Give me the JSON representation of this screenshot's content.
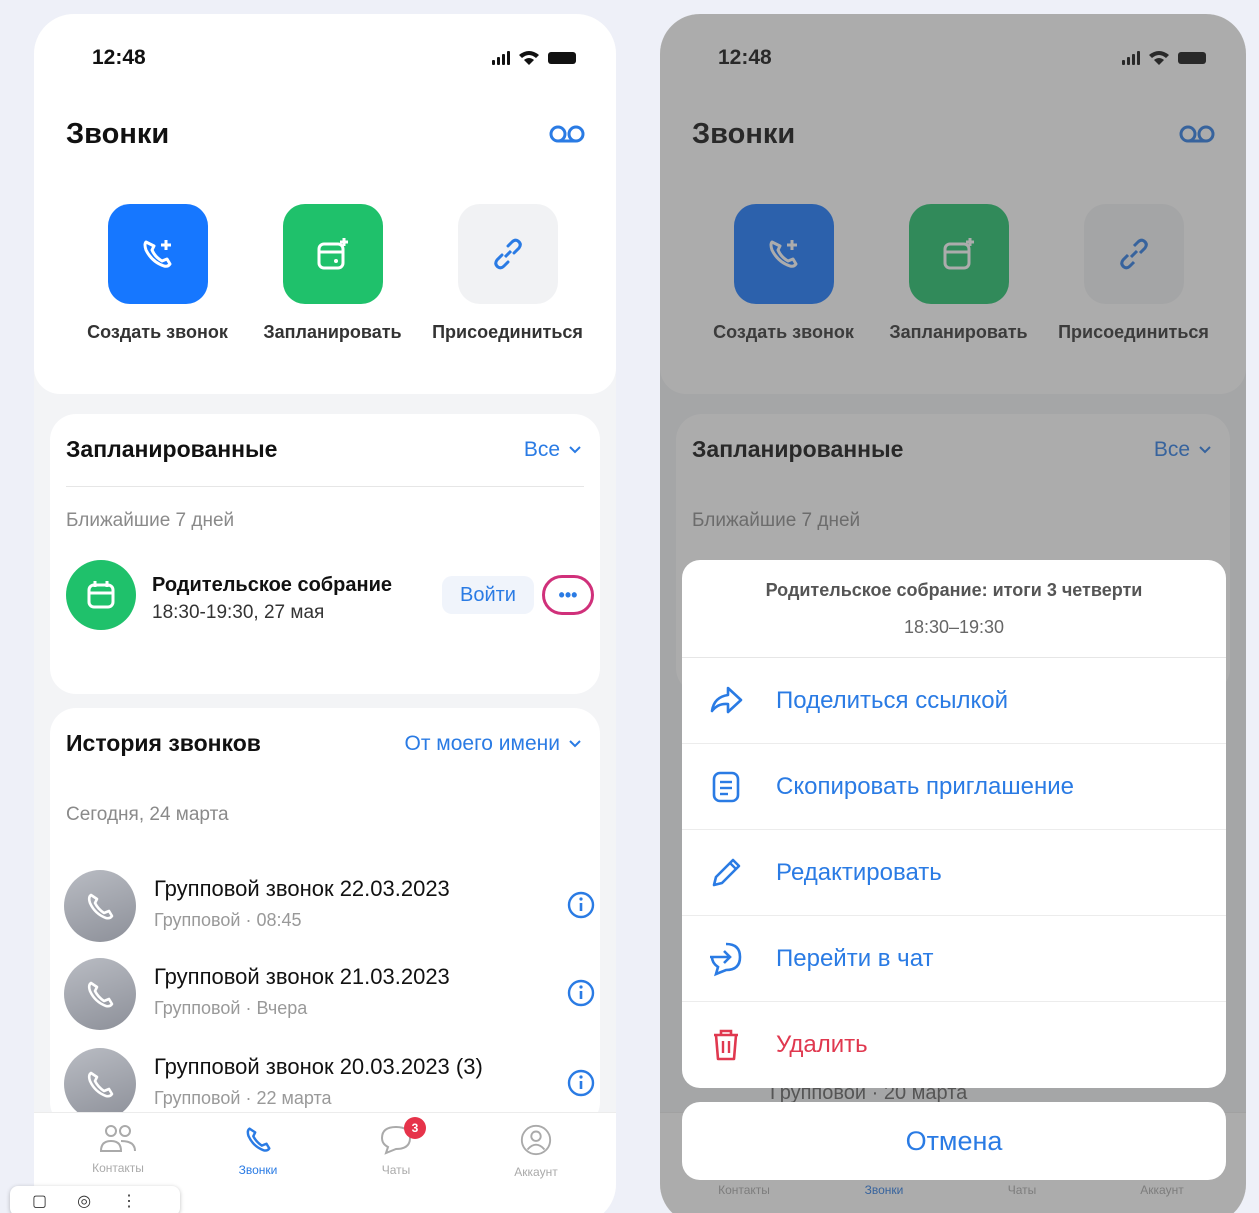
{
  "status": {
    "time": "12:48"
  },
  "header": {
    "title": "Звонки"
  },
  "actions": [
    {
      "label": "Создать звонок",
      "color": "#1677ff"
    },
    {
      "label": "Запланировать",
      "color": "#1fc16b"
    },
    {
      "label": "Присоединиться",
      "color": "#f1f2f4"
    }
  ],
  "scheduled": {
    "title": "Запланированные",
    "filter": "Все",
    "subtitle": "Ближайшие 7 дней",
    "event": {
      "title": "Родительское собрание",
      "time": "18:30-19:30, 27 мая",
      "join": "Войти",
      "more": "•••"
    }
  },
  "history": {
    "title": "История звонков",
    "filter": "От моего имени",
    "date": "Сегодня, 24 марта",
    "calls": [
      {
        "title": "Групповой звонок 22.03.2023",
        "subtitle": "Групповой · 08:45"
      },
      {
        "title": "Групповой звонок 21.03.2023",
        "subtitle": "Групповой · Вчера"
      },
      {
        "title": "Групповой звонок 20.03.2023 (3)",
        "subtitle": "Групповой · 22 марта"
      }
    ]
  },
  "tabs": {
    "contacts": "Контакты",
    "calls": "Звонки",
    "chats": "Чаты",
    "chats_badge": "3",
    "account": "Аккаунт"
  },
  "sheet": {
    "title": "Родительское собрание: итоги 3 четверти",
    "time": "18:30–19:30",
    "share": "Поделиться ссылкой",
    "copy": "Скопировать приглашение",
    "edit": "Редактировать",
    "chat": "Перейти в чат",
    "delete": "Удалить",
    "cancel": "Отмена",
    "peek": "Групповой · 20 марта"
  },
  "colors": {
    "accent": "#2a7be4",
    "danger": "#e0384f",
    "green": "#1fc16b",
    "blue": "#1677ff",
    "highlight": "#d0307a"
  }
}
